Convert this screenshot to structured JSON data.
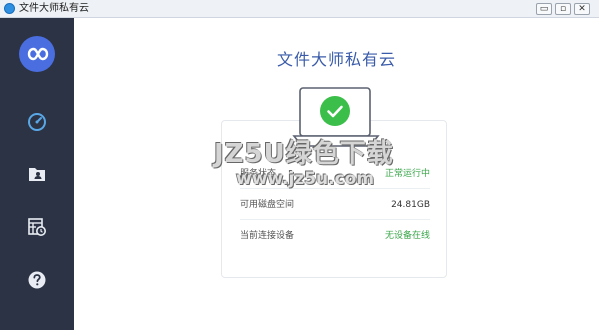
{
  "window": {
    "title": "文件大师私有云",
    "controls": {
      "minimize": "▭",
      "maximize": "▫",
      "close": "✕"
    }
  },
  "sidebar": {
    "logo_icon": "infinity-icon",
    "items": [
      {
        "icon": "dashboard-gauge-icon",
        "active": true
      },
      {
        "icon": "folder-user-icon",
        "active": false
      },
      {
        "icon": "table-clock-icon",
        "active": false
      },
      {
        "icon": "help-question-icon",
        "active": false
      }
    ]
  },
  "main": {
    "title": "文件大师私有云",
    "status_icon": "check-circle-icon",
    "rows": [
      {
        "label": "服务状态",
        "value": "正常运行中",
        "value_color": "#3aa64a"
      },
      {
        "label": "可用磁盘空间",
        "value": "24.81GB",
        "value_color": "#333333"
      },
      {
        "label": "当前连接设备",
        "value": "无设备在线",
        "value_color": "#3aa64a"
      }
    ]
  },
  "watermark": {
    "line1": "JZ5U绿色下载",
    "line2": "www.jz5u.com"
  },
  "colors": {
    "sidebar_bg": "#2b3344",
    "accent": "#4a6ee0",
    "title": "#3a5ba9",
    "success": "#3aa64a"
  }
}
